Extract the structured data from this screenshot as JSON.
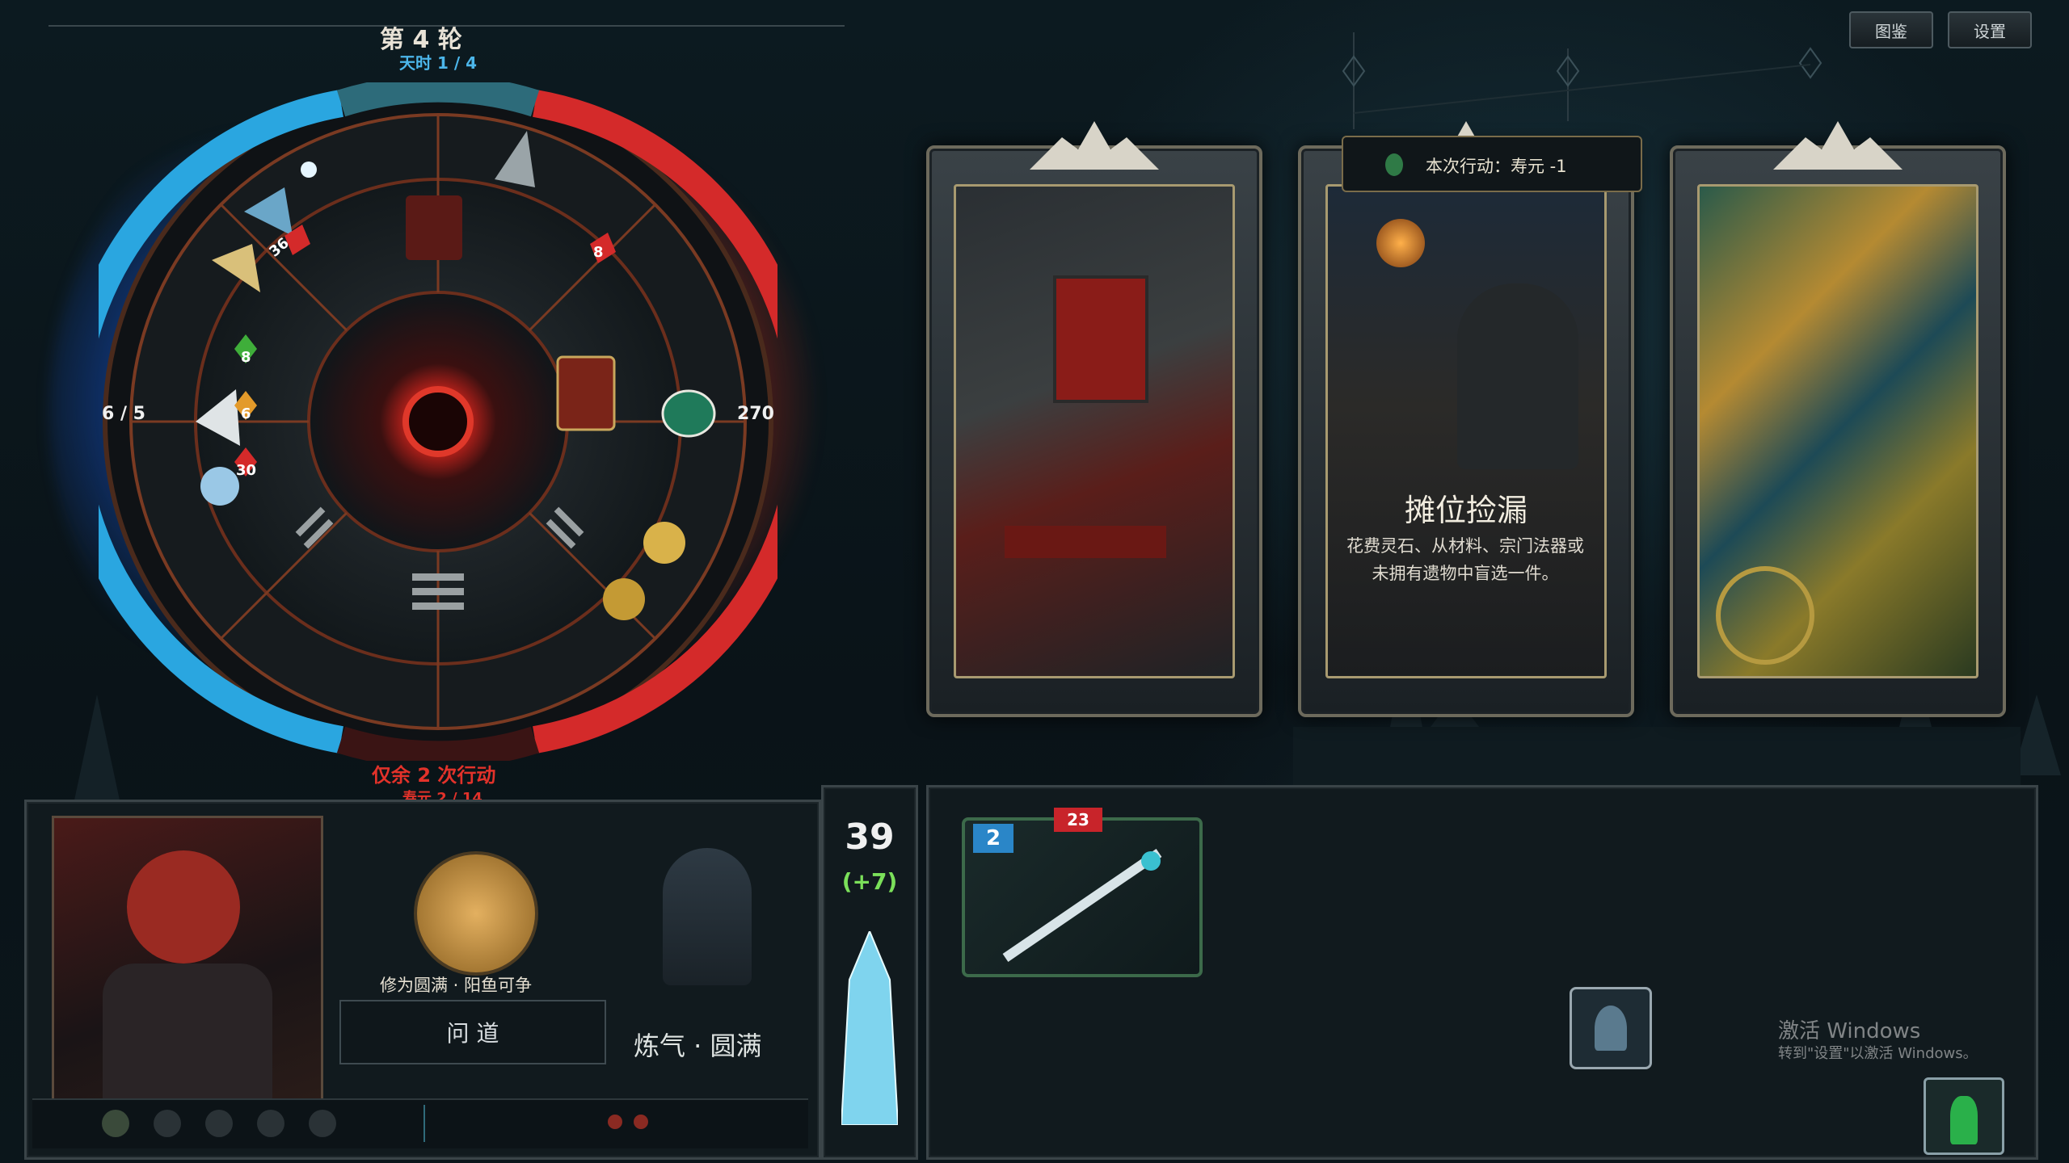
{
  "top_buttons": {
    "codex": "图鉴",
    "settings": "设置"
  },
  "wheel": {
    "round_label": "第 4 轮",
    "heaven_time": "天时 1 / 4",
    "left_stat": "6 / 5",
    "right_stat": "270",
    "badge_36": "36",
    "badge_8_top": "8",
    "badge_8_left": "8",
    "badge_6": "6",
    "badge_30": "30",
    "remaining_actions": "仅余 2 次行动",
    "lifespan": "寿元 2 / 14"
  },
  "cards": {
    "action_cost": "本次行动：寿元 -1",
    "middle_title": "摊位捡漏",
    "middle_desc": "花费灵石、从材料、宗门法器或未拥有遗物中盲选一件。"
  },
  "character": {
    "cultivation_status": "修为圆满 · 阳鱼可争",
    "ask_dao_button": "问  道",
    "realm": "炼气 · 圆满"
  },
  "energy": {
    "value": "39",
    "bonus": "(+7)"
  },
  "item": {
    "level": "2",
    "durability": "23"
  },
  "watermark": {
    "title": "激活 Windows",
    "subtitle": "转到\"设置\"以激活 Windows。"
  },
  "colors": {
    "accent_red": "#d42a2a",
    "accent_blue": "#2aa6e0",
    "gold": "#c9a75c",
    "bonus_green": "#7be05a"
  }
}
